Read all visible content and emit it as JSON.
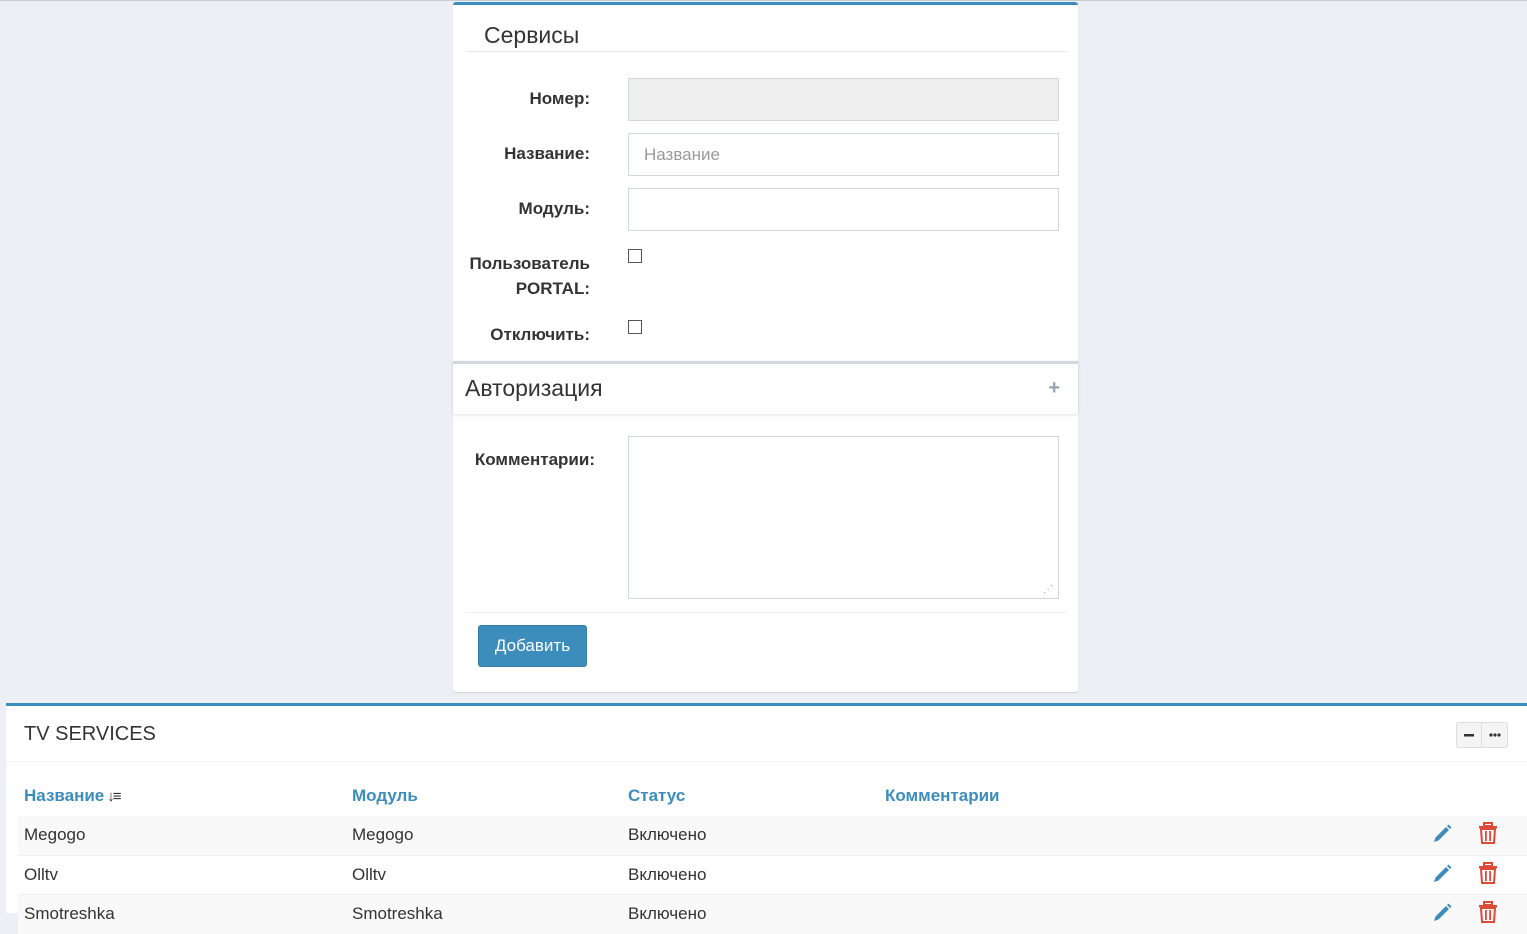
{
  "form": {
    "title": "Сервисы",
    "fields": {
      "number_label": "Номер:",
      "number_value": "",
      "name_label": "Название:",
      "name_placeholder": "Название",
      "module_label": "Модуль:",
      "module_value": "",
      "portal_user_label_line1": "Пользователь",
      "portal_user_label_line2": "PORTAL:",
      "portal_user_checked": false,
      "disable_label": "Отключить:",
      "disable_checked": false,
      "comments_label": "Комментарии:"
    },
    "auth_section": {
      "title": "Авторизация",
      "toggle_icon": "plus-icon"
    },
    "submit_label": "Добавить"
  },
  "table": {
    "title": "TV SERVICES",
    "tools": {
      "collapse_icon": "minus-icon",
      "more_icon": "ellipsis-icon"
    },
    "columns": [
      "Название",
      "Модуль",
      "Статус",
      "Комментарии"
    ],
    "sort_icon": "sort-amount-down-icon",
    "rows": [
      {
        "name": "Megogo",
        "module": "Megogo",
        "status": "Включено",
        "comment": ""
      },
      {
        "name": "Olltv",
        "module": "Olltv",
        "status": "Включено",
        "comment": ""
      },
      {
        "name": "Smotreshka",
        "module": "Smotreshka",
        "status": "Включено",
        "comment": ""
      }
    ]
  },
  "colors": {
    "accent": "#3c8dbc",
    "danger": "#dd4b39",
    "background": "#ecf0f5"
  }
}
